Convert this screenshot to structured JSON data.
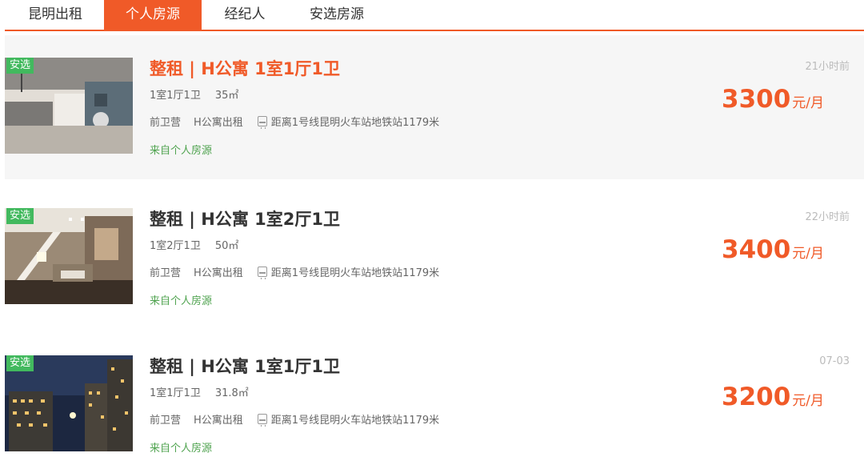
{
  "tabs": [
    {
      "label": "昆明出租",
      "active": false
    },
    {
      "label": "个人房源",
      "active": true
    },
    {
      "label": "经纪人",
      "active": false
    },
    {
      "label": "安选房源",
      "active": false
    }
  ],
  "colors": {
    "accent": "#f05a28",
    "badge": "#42b95e",
    "source": "#4fa34f"
  },
  "listings": [
    {
      "badge": "安选",
      "title": "整租 | H公寓 1室1厅1卫",
      "layout": "1室1厅1卫",
      "area": "35㎡",
      "district": "前卫营",
      "community": "H公寓出租",
      "metro_icon": "metro-icon",
      "distance": "距离1号线昆明火车站地铁站1179米",
      "source": "来自个人房源",
      "time": "21小时前",
      "price": "3300",
      "unit": "元/月"
    },
    {
      "badge": "安选",
      "title": "整租 | H公寓 1室2厅1卫",
      "layout": "1室2厅1卫",
      "area": "50㎡",
      "district": "前卫营",
      "community": "H公寓出租",
      "metro_icon": "metro-icon",
      "distance": "距离1号线昆明火车站地铁站1179米",
      "source": "来自个人房源",
      "time": "22小时前",
      "price": "3400",
      "unit": "元/月"
    },
    {
      "badge": "安选",
      "title": "整租 | H公寓 1室1厅1卫",
      "layout": "1室1厅1卫",
      "area": "31.8㎡",
      "district": "前卫营",
      "community": "H公寓出租",
      "metro_icon": "metro-icon",
      "distance": "距离1号线昆明火车站地铁站1179米",
      "source": "来自个人房源",
      "time": "07-03",
      "price": "3200",
      "unit": "元/月"
    }
  ]
}
